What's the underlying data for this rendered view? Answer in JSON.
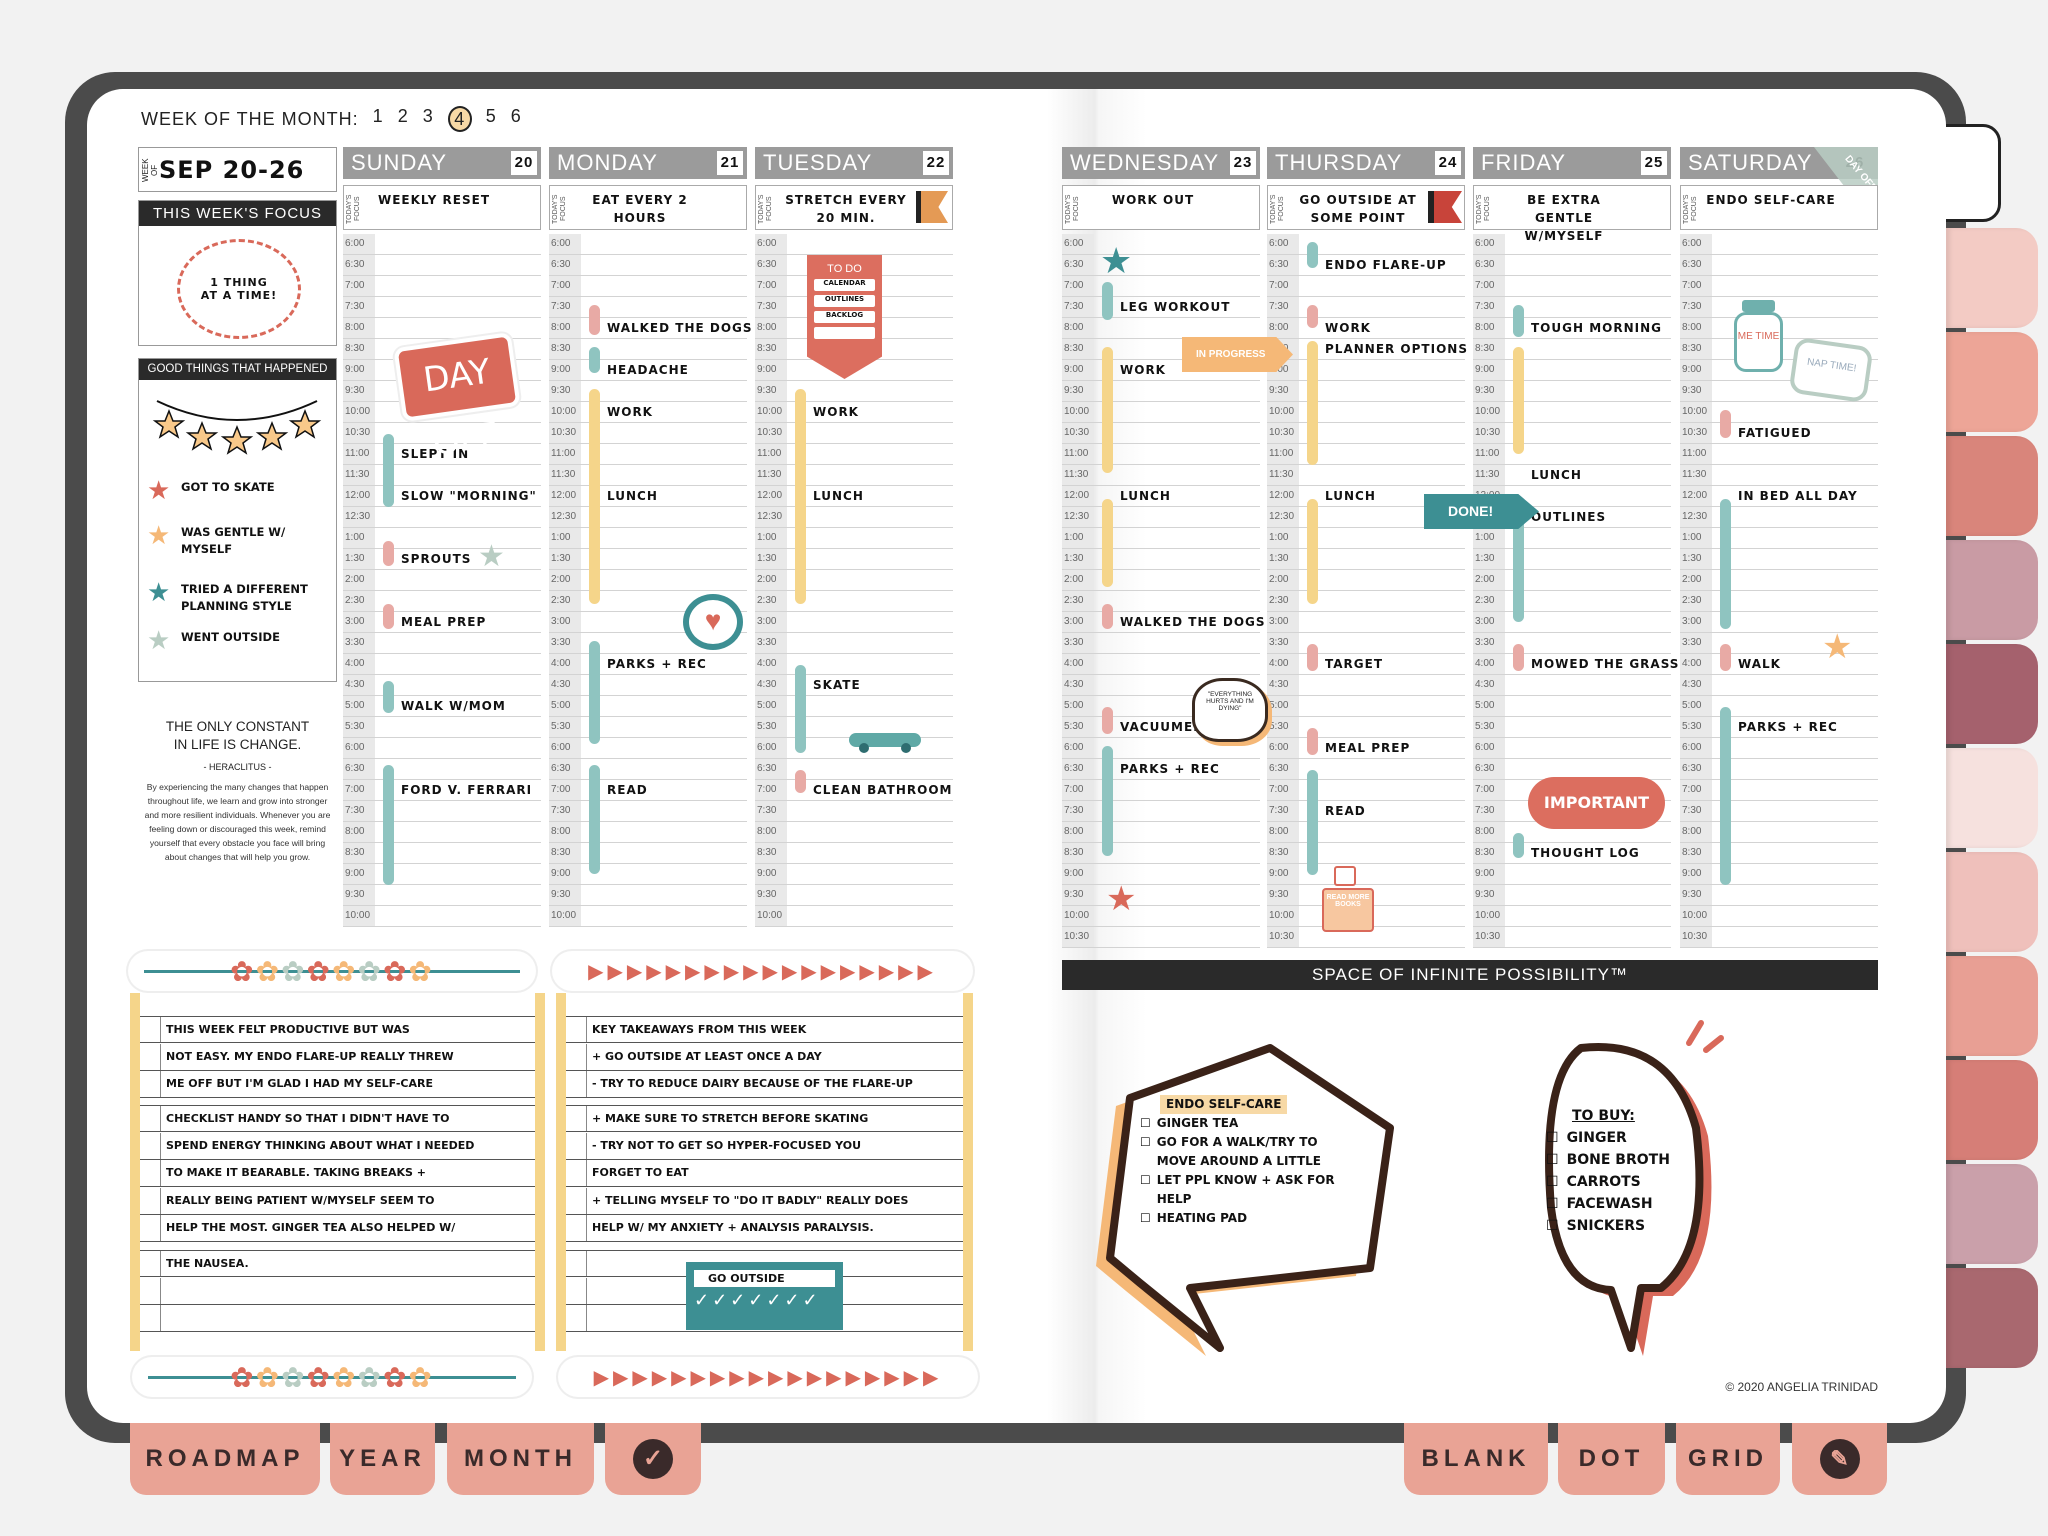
{
  "week_of_month": {
    "label": "WEEK OF THE MONTH:",
    "weeks": [
      "1",
      "2",
      "3",
      "4",
      "5",
      "6"
    ],
    "selected": "4"
  },
  "week_box": {
    "label": "WEEK OF",
    "value": "SEP 20-26"
  },
  "focus": {
    "title": "THIS WEEK'S FOCUS",
    "sticker_lines": [
      "1 THING",
      "AT A TIME!"
    ]
  },
  "good_things": {
    "title": "GOOD THINGS THAT HAPPENED",
    "items": [
      {
        "text": "GOT TO SKATE",
        "color": "#d9695a"
      },
      {
        "text": "WAS GENTLE W/ MYSELF",
        "color": "#f5b877"
      },
      {
        "text": "TRIED A DIFFERENT PLANNING STYLE",
        "color": "#3d8f93"
      },
      {
        "text": "WENT OUTSIDE",
        "color": "#b9cdc3"
      }
    ]
  },
  "quote": {
    "text": "THE ONLY CONSTANT IN LIFE IS CHANGE.",
    "author": "- HERACLITUS -",
    "body": "By experiencing the many changes that happen throughout life, we learn and grow into stronger and more resilient individuals. Whenever you are feeling down or discouraged this week, remind yourself that every obstacle you face will bring about changes that will help you grow."
  },
  "times": [
    "6:00",
    "6:30",
    "7:00",
    "7:30",
    "8:00",
    "8:30",
    "9:00",
    "9:30",
    "10:00",
    "10:30",
    "11:00",
    "11:30",
    "12:00",
    "12:30",
    "1:00",
    "1:30",
    "2:00",
    "2:30",
    "3:00",
    "3:30",
    "4:00",
    "4:30",
    "5:00",
    "5:30",
    "6:00",
    "6:30",
    "7:00",
    "7:30",
    "8:00",
    "8:30",
    "9:00",
    "9:30",
    "10:00",
    "10:30"
  ],
  "focus_label": "TODAY'S FOCUS",
  "colors": {
    "teal": "#8fc4c0",
    "yellow": "#f5d58a",
    "pink": "#e8aaa5",
    "red": "#d9695a",
    "orange": "#f5b877",
    "dark_teal": "#3d8f93",
    "sage": "#b9cdc3"
  },
  "days": [
    {
      "name": "SUNDAY",
      "date": "20",
      "focus": "WEEKLY RESET",
      "entries": [
        {
          "row": 10,
          "text": "SLEPT IN"
        },
        {
          "row": 12,
          "text": "SLOW \"MORNING\""
        },
        {
          "row": 15,
          "text": "SPROUTS"
        },
        {
          "row": 18,
          "text": "MEAL PREP"
        },
        {
          "row": 22,
          "text": "WALK W/MOM"
        },
        {
          "row": 26,
          "text": "FORD V. FERRARI"
        }
      ],
      "bars": [
        {
          "from": 9.5,
          "to": 13,
          "color": "teal"
        },
        {
          "from": 14.6,
          "to": 15.8,
          "color": "pink"
        },
        {
          "from": 17.6,
          "to": 18.8,
          "color": "pink"
        },
        {
          "from": 21.3,
          "to": 22.8,
          "color": "teal"
        },
        {
          "from": 25.3,
          "to": 31,
          "color": "teal"
        }
      ]
    },
    {
      "name": "MONDAY",
      "date": "21",
      "focus": "EAT EVERY 2 HOURS",
      "entries": [
        {
          "row": 4,
          "text": "WALKED THE DOGS"
        },
        {
          "row": 6,
          "text": "HEADACHE"
        },
        {
          "row": 8,
          "text": "WORK"
        },
        {
          "row": 12,
          "text": "LUNCH"
        },
        {
          "row": 20,
          "text": "PARKS + REC"
        },
        {
          "row": 26,
          "text": "READ"
        }
      ],
      "bars": [
        {
          "from": 3.4,
          "to": 4.8,
          "color": "pink"
        },
        {
          "from": 5.4,
          "to": 6.6,
          "color": "teal"
        },
        {
          "from": 7.4,
          "to": 17.6,
          "color": "yellow"
        },
        {
          "from": 19.4,
          "to": 24.3,
          "color": "teal"
        },
        {
          "from": 25.3,
          "to": 30.5,
          "color": "teal"
        }
      ]
    },
    {
      "name": "TUESDAY",
      "date": "22",
      "focus": "STRETCH EVERY 20 MIN.",
      "entries": [
        {
          "row": 8,
          "text": "WORK"
        },
        {
          "row": 12,
          "text": "LUNCH"
        },
        {
          "row": 21,
          "text": "SKATE"
        },
        {
          "row": 26,
          "text": "CLEAN BATHROOM"
        }
      ],
      "bars": [
        {
          "from": 7.4,
          "to": 17.6,
          "color": "yellow"
        },
        {
          "from": 20.5,
          "to": 24.7,
          "color": "teal"
        },
        {
          "from": 25.5,
          "to": 26.6,
          "color": "pink"
        }
      ]
    },
    {
      "name": "WEDNESDAY",
      "date": "23",
      "focus": "WORK OUT",
      "entries": [
        {
          "row": 3,
          "text": "LEG WORKOUT"
        },
        {
          "row": 6,
          "text": "WORK"
        },
        {
          "row": 12,
          "text": "LUNCH"
        },
        {
          "row": 18,
          "text": "WALKED THE DOGS"
        },
        {
          "row": 23,
          "text": "VACUUMED"
        },
        {
          "row": 25,
          "text": "PARKS + REC"
        }
      ],
      "bars": [
        {
          "from": 2.3,
          "to": 4.1,
          "color": "teal"
        },
        {
          "from": 5.4,
          "to": 11.4,
          "color": "yellow"
        },
        {
          "from": 12.6,
          "to": 16.8,
          "color": "yellow"
        },
        {
          "from": 17.6,
          "to": 18.8,
          "color": "pink"
        },
        {
          "from": 22.5,
          "to": 23.8,
          "color": "pink"
        },
        {
          "from": 24.4,
          "to": 29.6,
          "color": "teal"
        }
      ]
    },
    {
      "name": "THURSDAY",
      "date": "24",
      "focus": "GO OUTSIDE AT SOME POINT",
      "entries": [
        {
          "row": 1,
          "text": "ENDO FLARE-UP"
        },
        {
          "row": 4,
          "text": "WORK"
        },
        {
          "row": 5,
          "text": "PLANNER OPTIONS"
        },
        {
          "row": 12,
          "text": "LUNCH"
        },
        {
          "row": 20,
          "text": "TARGET"
        },
        {
          "row": 24,
          "text": "MEAL PREP"
        },
        {
          "row": 27,
          "text": "READ"
        }
      ],
      "bars": [
        {
          "from": 0.4,
          "to": 1.6,
          "color": "teal"
        },
        {
          "from": 3.4,
          "to": 4.5,
          "color": "pink"
        },
        {
          "from": 5.1,
          "to": 11,
          "color": "yellow"
        },
        {
          "from": 12.6,
          "to": 17.6,
          "color": "yellow"
        },
        {
          "from": 19.5,
          "to": 20.8,
          "color": "pink"
        },
        {
          "from": 23.5,
          "to": 24.8,
          "color": "pink"
        },
        {
          "from": 25.5,
          "to": 30.5,
          "color": "teal"
        }
      ]
    },
    {
      "name": "FRIDAY",
      "date": "25",
      "focus": "BE EXTRA GENTLE W/MYSELF",
      "entries": [
        {
          "row": 4,
          "text": "TOUGH MORNING"
        },
        {
          "row": 11,
          "text": "LUNCH"
        },
        {
          "row": 13,
          "text": "OUTLINES"
        },
        {
          "row": 20,
          "text": "MOWED THE GRASS"
        },
        {
          "row": 29,
          "text": "THOUGHT LOG"
        }
      ],
      "bars": [
        {
          "from": 3.4,
          "to": 4.9,
          "color": "teal"
        },
        {
          "from": 5.4,
          "to": 10.5,
          "color": "yellow"
        },
        {
          "from": 13.6,
          "to": 18.5,
          "color": "teal"
        },
        {
          "from": 19.5,
          "to": 20.8,
          "color": "pink"
        },
        {
          "from": 28.5,
          "to": 29.7,
          "color": "teal"
        }
      ]
    },
    {
      "name": "SATURDAY",
      "date": "26",
      "focus": "ENDO SELF-CARE",
      "corner": "DAY OFF",
      "entries": [
        {
          "row": 9,
          "text": "FATIGUED"
        },
        {
          "row": 12,
          "text": "IN BED ALL DAY"
        },
        {
          "row": 20,
          "text": "WALK"
        },
        {
          "row": 23,
          "text": "PARKS + REC"
        }
      ],
      "bars": [
        {
          "from": 8.4,
          "to": 9.7,
          "color": "pink"
        },
        {
          "from": 12.6,
          "to": 18.8,
          "color": "teal"
        },
        {
          "from": 19.5,
          "to": 20.8,
          "color": "pink"
        },
        {
          "from": 22.5,
          "to": 31,
          "color": "teal"
        }
      ]
    }
  ],
  "stickers": {
    "day_off": "DAY OFF",
    "todo": {
      "title": "TO DO",
      "items": [
        "CALENDAR",
        "OUTLINES",
        "BACKLOG",
        ""
      ]
    },
    "in_progress": "IN PROGRESS",
    "done": "DONE!",
    "important": "IMPORTANT",
    "me_time": "ME TIME",
    "nap_time": "NAP TIME!",
    "speech": "\"EVERYTHING HURTS AND I'M DYING\"",
    "books": "READ MORE BOOKS",
    "habit": {
      "title": "GO OUTSIDE",
      "checks": "✓✓✓✓✓✓✓"
    }
  },
  "banner": "SPACE OF INFINITE POSSIBILITY™",
  "notes": {
    "left": [
      [
        "THIS WEEK FELT PRODUCTIVE BUT WAS",
        "NOT EASY. MY ENDO FLARE-UP REALLY THREW",
        "ME OFF BUT I'M GLAD I HAD MY SELF-CARE"
      ],
      [
        "CHECKLIST HANDY SO THAT I DIDN'T HAVE TO",
        "SPEND ENERGY THINKING ABOUT WHAT I NEEDED",
        "TO MAKE IT BEARABLE. TAKING BREAKS +",
        "REALLY BEING PATIENT W/MYSELF SEEM TO",
        "HELP THE MOST. GINGER TEA ALSO HELPED W/"
      ],
      [
        "THE NAUSEA.",
        "",
        ""
      ]
    ],
    "right": [
      [
        "KEY TAKEAWAYS FROM THIS WEEK",
        "+ GO OUTSIDE AT LEAST ONCE A DAY",
        "- TRY TO REDUCE DAIRY BECAUSE OF THE FLARE-UP"
      ],
      [
        "+ MAKE SURE TO STRETCH BEFORE SKATING",
        "- TRY NOT TO GET SO HYPER-FOCUSED YOU",
        "  FORGET TO EAT",
        "+ TELLING MYSELF TO \"DO IT BADLY\" REALLY DOES",
        "  HELP W/ MY ANXIETY + ANALYSIS PARALYSIS."
      ],
      [
        "",
        "",
        ""
      ]
    ]
  },
  "endo_bubble": {
    "title": "ENDO SELF-CARE",
    "items": [
      "GINGER TEA",
      "GO FOR A WALK/TRY TO MOVE AROUND A LITTLE",
      "LET PPL KNOW + ASK FOR HELP",
      "HEATING PAD"
    ]
  },
  "buy_bubble": {
    "title": "TO BUY:",
    "items": [
      "GINGER",
      "BONE BROTH",
      "CARROTS",
      "FACEWASH",
      "SNICKERS"
    ]
  },
  "copyright": "© 2020 ANGELIA TRINIDAD",
  "bottom_tabs_left": [
    "ROADMAP",
    "YEAR",
    "MONTH"
  ],
  "bottom_tabs_right": [
    "BLANK",
    "DOT",
    "GRID"
  ],
  "side_tab_colors": [
    "#f3cbc4",
    "#eda597",
    "#d9857b",
    "#c99ba4",
    "#a5616d",
    "#f6e1de",
    "#efc0bb",
    "#e89f94",
    "#d67e77",
    "#caa0aa",
    "#a9686f"
  ]
}
